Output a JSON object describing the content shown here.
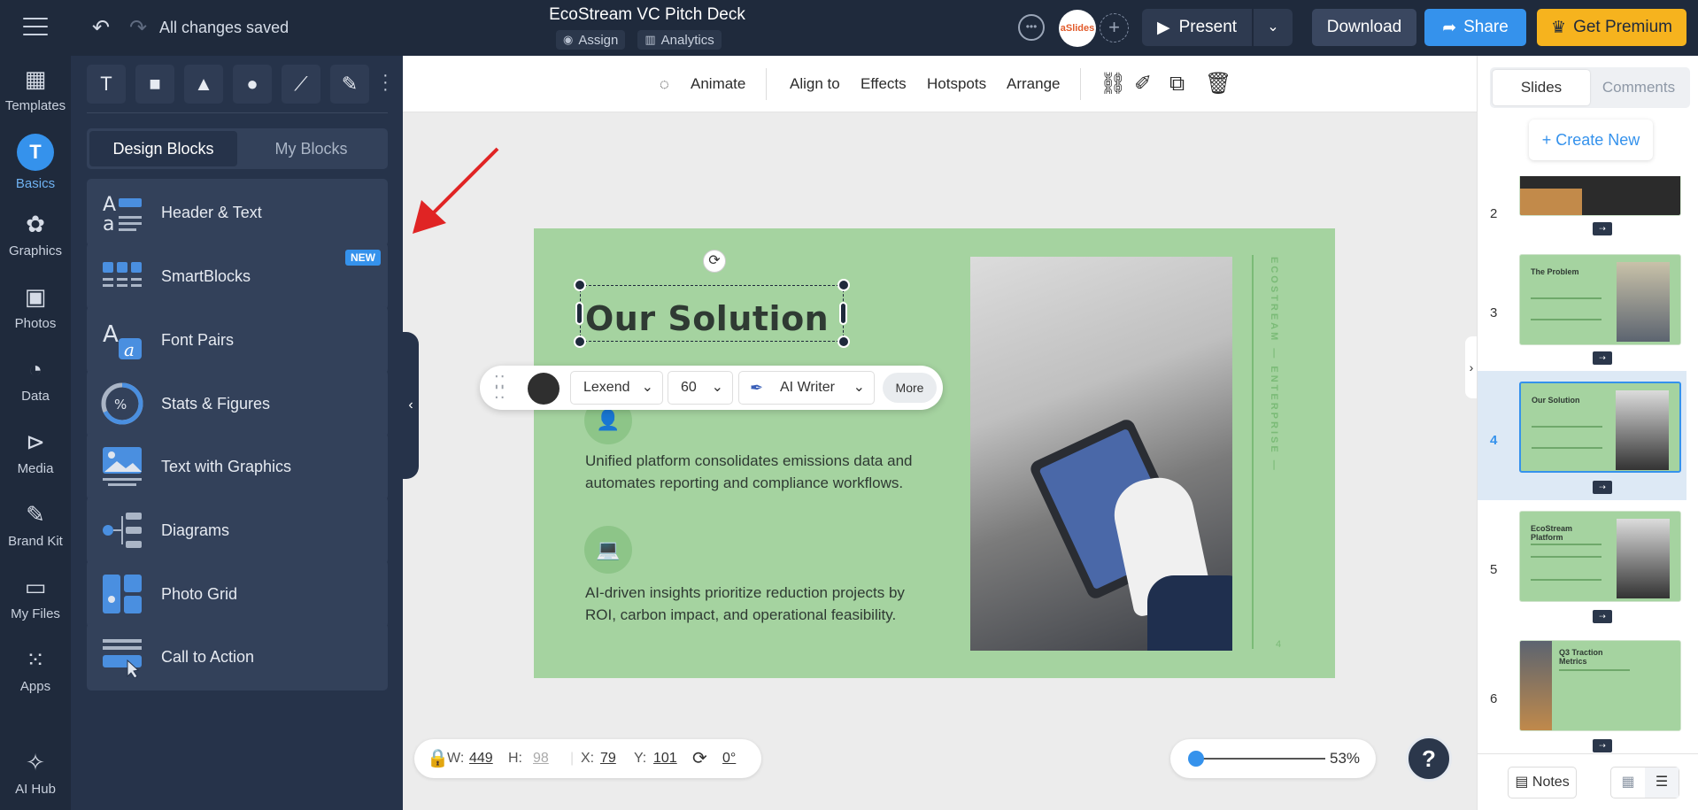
{
  "topbar": {
    "saved_status": "All changes saved",
    "doc_title": "EcoStream VC Pitch Deck",
    "assign_label": "Assign",
    "analytics_label": "Analytics",
    "avatar_text": "aSlides",
    "present_label": "Present",
    "download_label": "Download",
    "share_label": "Share",
    "premium_label": "Get Premium"
  },
  "rail": [
    {
      "label": "Templates",
      "icon": "templates-icon"
    },
    {
      "label": "Basics",
      "icon": "text-icon",
      "glyph": "T"
    },
    {
      "label": "Graphics",
      "icon": "graphics-icon"
    },
    {
      "label": "Photos",
      "icon": "photos-icon"
    },
    {
      "label": "Data",
      "icon": "data-icon"
    },
    {
      "label": "Media",
      "icon": "media-icon"
    },
    {
      "label": "Brand Kit",
      "icon": "brand-kit-icon"
    },
    {
      "label": "My Files",
      "icon": "folder-icon"
    },
    {
      "label": "Apps",
      "icon": "apps-icon"
    },
    {
      "label": "AI Hub",
      "icon": "ai-hub-icon"
    }
  ],
  "panel": {
    "tools": [
      "text-tool",
      "rectangle-tool",
      "triangle-tool",
      "circle-tool",
      "line-tool",
      "pen-tool"
    ],
    "text_tool_glyph": "T",
    "tab_design": "Design Blocks",
    "tab_my": "My Blocks",
    "blocks": [
      {
        "label": "Header & Text"
      },
      {
        "label": "SmartBlocks",
        "badge": "NEW"
      },
      {
        "label": "Font Pairs"
      },
      {
        "label": "Stats & Figures"
      },
      {
        "label": "Text with Graphics"
      },
      {
        "label": "Diagrams"
      },
      {
        "label": "Photo Grid"
      },
      {
        "label": "Call to Action"
      }
    ]
  },
  "editor_toolbar": {
    "animate": "Animate",
    "align_to": "Align to",
    "effects": "Effects",
    "hotspots": "Hotspots",
    "arrange": "Arrange"
  },
  "slide": {
    "title": "Our Solution",
    "para1": "Unified platform consolidates emissions data and automates reporting and compliance workflows.",
    "para2": "AI-driven insights prioritize reduction projects by ROI, carbon impact, and operational feasibility.",
    "vertical_text": "ECOSTREAM — ENTERPRISE —",
    "page_number": "4",
    "background_color": "#a5d3a0"
  },
  "text_toolbar": {
    "font": "Lexend",
    "size": "60",
    "ai_writer": "AI Writer",
    "more": "More",
    "text_color": "#2f2f2f"
  },
  "dimensions": {
    "w_label": "W:",
    "w": "449",
    "h_label": "H:",
    "h": "98",
    "x_label": "X:",
    "x": "79",
    "y_label": "Y:",
    "y": "101",
    "rotation": "0°"
  },
  "zoom": {
    "value": "53%"
  },
  "help": {
    "glyph": "?"
  },
  "right_panel": {
    "tab_slides": "Slides",
    "tab_comments": "Comments",
    "create_new": "+ Create New",
    "thumbnails": [
      {
        "number": "2",
        "title": ""
      },
      {
        "number": "3",
        "title": "The Problem"
      },
      {
        "number": "4",
        "title": "Our Solution",
        "active": true
      },
      {
        "number": "5",
        "title": "EcoStream Platform"
      },
      {
        "number": "6",
        "title": "Q3 Traction Metrics"
      }
    ],
    "notes_label": "Notes"
  },
  "colors": {
    "accent": "#3592ec",
    "premium": "#f6b31e",
    "topbar": "#1f2a3c",
    "annotation_arrow": "#e02424"
  }
}
